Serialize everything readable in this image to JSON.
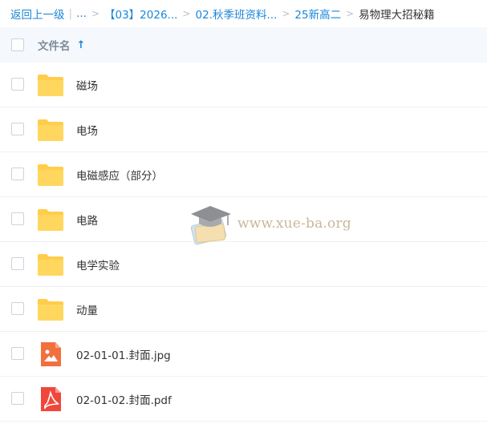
{
  "breadcrumb": {
    "back": "返回上一级",
    "ellipsis": "...",
    "separator": ">",
    "items": [
      "【03】2026...",
      "02.秋季班资料...",
      "25新高二"
    ],
    "current": "易物理大招秘籍"
  },
  "header": {
    "name_label": "文件名",
    "sort_icon": "↑"
  },
  "files": [
    {
      "name": "磁场",
      "type": "folder"
    },
    {
      "name": "电场",
      "type": "folder"
    },
    {
      "name": "电磁感应（部分）",
      "type": "folder"
    },
    {
      "name": "电路",
      "type": "folder"
    },
    {
      "name": "电学实验",
      "type": "folder"
    },
    {
      "name": "动量",
      "type": "folder"
    },
    {
      "name": "02-01-01.封面.jpg",
      "type": "image"
    },
    {
      "name": "02-01-02.封面.pdf",
      "type": "pdf"
    }
  ],
  "watermark": {
    "text": "www.xue-ba.org"
  },
  "colors": {
    "link": "#1a86d8",
    "folder": "#ffcd4a",
    "image_icon": "#f36f3e",
    "pdf_icon": "#f0473b",
    "header_bg": "#f5f8fc"
  }
}
